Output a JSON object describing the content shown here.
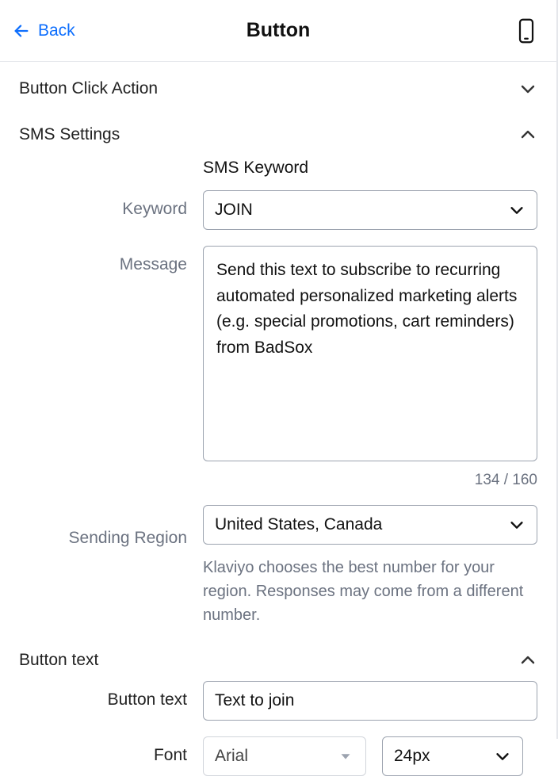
{
  "header": {
    "back_label": "Back",
    "title": "Button"
  },
  "sections": {
    "click_action": {
      "title": "Button Click Action"
    },
    "sms": {
      "title": "SMS Settings",
      "subheading": "SMS Keyword",
      "keyword_label": "Keyword",
      "keyword_value": "JOIN",
      "message_label": "Message",
      "message_value": "Send this text to subscribe to recurring automated personalized marketing alerts (e.g. special promotions, cart reminders) from BadSox",
      "char_count": "134 / 160",
      "region_label": "Sending Region",
      "region_value": "United States, Canada",
      "region_helper": "Klaviyo chooses the best number for your region. Responses may come from a different number."
    },
    "button_text": {
      "title": "Button text",
      "text_label": "Button text",
      "text_value": "Text to join",
      "font_label": "Font",
      "font_value": "Arial",
      "size_value": "24px"
    }
  }
}
